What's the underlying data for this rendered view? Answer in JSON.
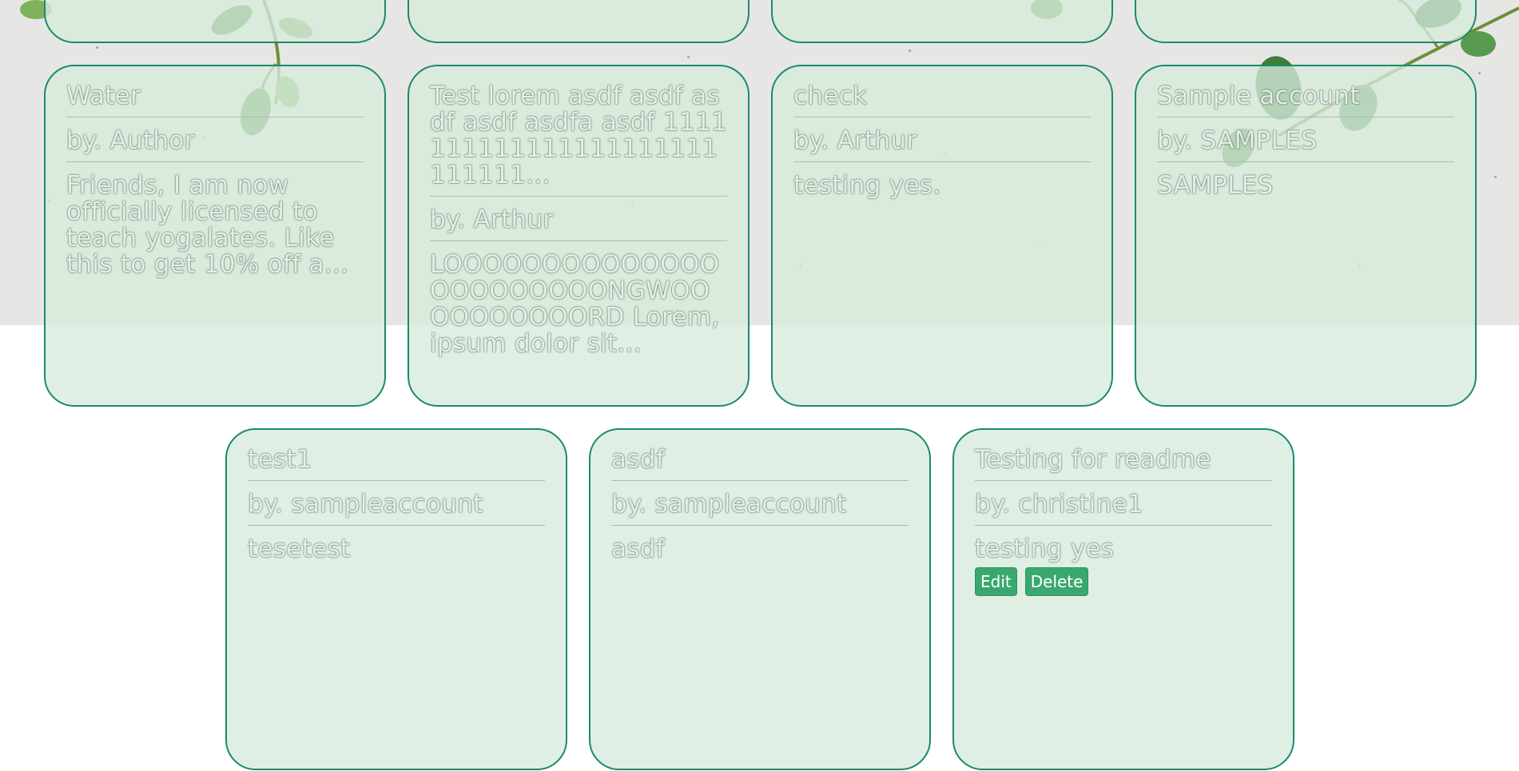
{
  "top_row_cards": [
    {},
    {},
    {},
    {}
  ],
  "cards_row1": [
    {
      "title": "Water",
      "author": "by. Author",
      "body": "Friends, I am now officially licensed to teach yogalates. Like this to get 10% off a..."
    },
    {
      "title": "Test lorem asdf asdf asdf asdf asdfa asdf 1111111111111111111111111111...",
      "author": "by. Arthur",
      "body": "LOOOOOOOOOOOOOOOOOOOOOOONGWOOOOOOOOOORD Lorem, ipsum dolor sit..."
    },
    {
      "title": "check",
      "author": "by. Arthur",
      "body": "testing yes."
    },
    {
      "title": "Sample account",
      "author": "by. SAMPLES",
      "body": "SAMPLES"
    }
  ],
  "cards_row2": [
    {
      "title": "test1",
      "author": "by. sampleaccount",
      "body": "tesetest"
    },
    {
      "title": "asdf",
      "author": "by. sampleaccount",
      "body": "asdf"
    },
    {
      "title": "Testing for readme",
      "author": "by. christine1",
      "body": "testing yes",
      "edit_label": "Edit",
      "delete_label": "Delete"
    }
  ],
  "colors": {
    "card_border": "#1b8a6b",
    "card_fill": "#d6eadb",
    "button": "#3aa86e",
    "leaf": "#3f7d3c"
  }
}
